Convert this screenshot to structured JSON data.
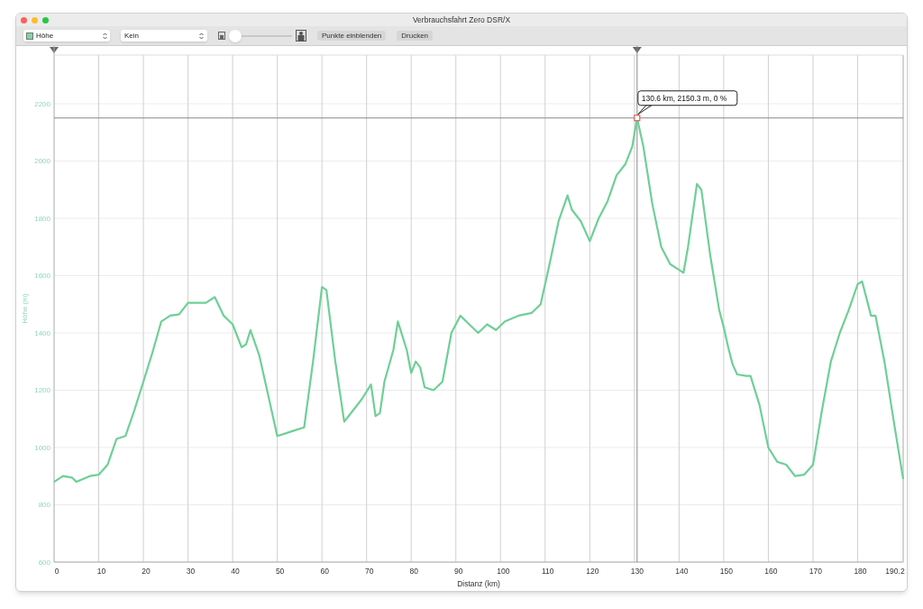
{
  "window": {
    "title": "Verbrauchsfahrt Zero DSR/X"
  },
  "toolbar": {
    "series_select": {
      "value": "Höhe",
      "color": "#7fd4a8"
    },
    "compare_select": {
      "value": "Kein"
    },
    "zoom_slider": {
      "level": 0.0
    },
    "buttons": [
      "Punkte einblenden",
      "Drucken"
    ]
  },
  "chart": {
    "chart_data": {
      "type": "line",
      "xlabel": "Distanz (km)",
      "ylabel": "Höhe (m)",
      "xlim": [
        0,
        190.2
      ],
      "ylim": [
        600,
        2370
      ],
      "xticks": [
        0,
        10,
        20,
        30,
        40,
        50,
        60,
        70,
        80,
        90,
        100,
        110,
        120,
        130,
        140,
        150,
        160,
        170,
        180,
        190.2
      ],
      "yticks": [
        600,
        800,
        1000,
        1200,
        1400,
        1600,
        1800,
        2000,
        2200
      ],
      "x": [
        0,
        2,
        4,
        5,
        8,
        10,
        12,
        14,
        16,
        18,
        20,
        22,
        24,
        26,
        28,
        30,
        34,
        36,
        38,
        40,
        42,
        43,
        44,
        46,
        48,
        50,
        52,
        54,
        56,
        58,
        60,
        61,
        63,
        65,
        67,
        69,
        71,
        72,
        73,
        74,
        76,
        77,
        79,
        80,
        81,
        82,
        83,
        85,
        87,
        89,
        91,
        93,
        95,
        97,
        99,
        101,
        104,
        107,
        109,
        111,
        113,
        115,
        116,
        118,
        120,
        122,
        124,
        126,
        128,
        129.5,
        130.6,
        132,
        134,
        136,
        138,
        140,
        141,
        142,
        144,
        145,
        147,
        149,
        150,
        151,
        152,
        153,
        155,
        156,
        158,
        160,
        162,
        164,
        166,
        168,
        170,
        172,
        174,
        176,
        178,
        180,
        181,
        183,
        184,
        186,
        188,
        190.2
      ],
      "grid": true,
      "ref_lines": [
        {
          "axis": "y",
          "value": 2150.3
        },
        {
          "axis": "x",
          "value": 130.6
        }
      ],
      "series": [
        {
          "color": "#6fcf97",
          "values": [
            880,
            900,
            895,
            880,
            900,
            905,
            940,
            1030,
            1040,
            1130,
            1230,
            1330,
            1440,
            1460,
            1465,
            1505,
            1505,
            1525,
            1460,
            1430,
            1350,
            1360,
            1410,
            1320,
            1180,
            1040,
            1050,
            1060,
            1070,
            1300,
            1560,
            1550,
            1300,
            1090,
            1130,
            1170,
            1220,
            1110,
            1120,
            1230,
            1340,
            1440,
            1340,
            1260,
            1300,
            1280,
            1210,
            1200,
            1230,
            1400,
            1460,
            1430,
            1400,
            1430,
            1410,
            1440,
            1460,
            1470,
            1500,
            1640,
            1790,
            1880,
            1830,
            1790,
            1720,
            1800,
            1860,
            1950,
            1990,
            2050,
            2150,
            2050,
            1850,
            1700,
            1640,
            1620,
            1610,
            1700,
            1920,
            1900,
            1670,
            1480,
            1420,
            1350,
            1290,
            1255,
            1250,
            1250,
            1150,
            1000,
            950,
            940,
            900,
            905,
            940,
            1130,
            1300,
            1400,
            1480,
            1570,
            1580,
            1460,
            1460,
            1300,
            1100,
            890
          ]
        }
      ],
      "annotations": [
        {
          "x": 130.6,
          "y": 2150.3,
          "text": "130.6 km, 2150.3 m, 0 %"
        }
      ]
    }
  }
}
